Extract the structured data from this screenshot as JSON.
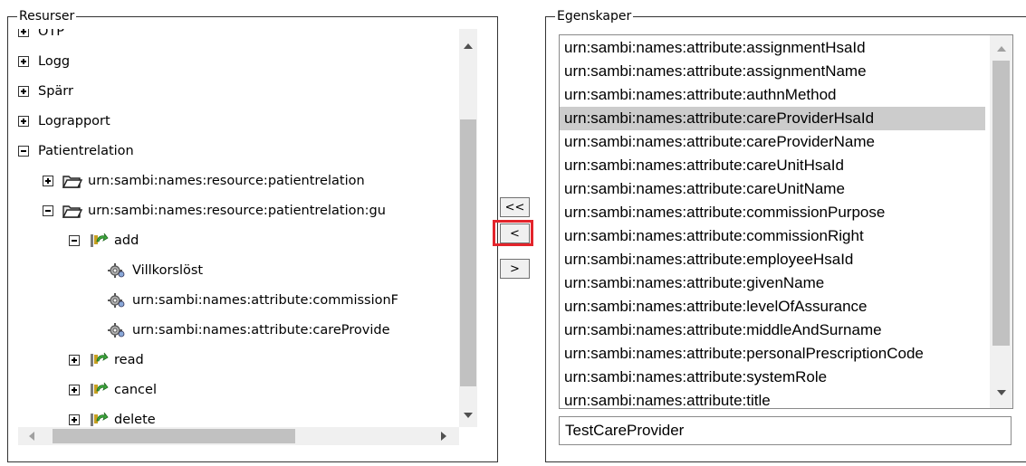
{
  "resources": {
    "legend": "Resurser",
    "rows": [
      {
        "label": "OTP",
        "level": 0,
        "toggle": "plus",
        "icon": ""
      },
      {
        "label": "Logg",
        "level": 0,
        "toggle": "plus",
        "icon": ""
      },
      {
        "label": "Spärr",
        "level": 0,
        "toggle": "plus",
        "icon": ""
      },
      {
        "label": "Lograpport",
        "level": 0,
        "toggle": "plus",
        "icon": ""
      },
      {
        "label": "Patientrelation",
        "level": 0,
        "toggle": "minus",
        "icon": ""
      },
      {
        "label": "urn:sambi:names:resource:patientrelation",
        "level": 1,
        "toggle": "plus",
        "icon": "folder-icon"
      },
      {
        "label": "urn:sambi:names:resource:patientrelation:gu",
        "level": 1,
        "toggle": "minus",
        "icon": "folder-icon"
      },
      {
        "label": "add",
        "level": 2,
        "toggle": "minus",
        "icon": "action-icon"
      },
      {
        "label": "Villkorslöst",
        "level": 3,
        "toggle": "",
        "icon": "gear-icon"
      },
      {
        "label": "urn:sambi:names:attribute:commissionF",
        "level": 3,
        "toggle": "",
        "icon": "gear-icon"
      },
      {
        "label": "urn:sambi:names:attribute:careProvide",
        "level": 3,
        "toggle": "",
        "icon": "gear-icon"
      },
      {
        "label": "read",
        "level": 2,
        "toggle": "plus",
        "icon": "action-icon"
      },
      {
        "label": "cancel",
        "level": 2,
        "toggle": "plus",
        "icon": "action-icon"
      },
      {
        "label": "delete",
        "level": 2,
        "toggle": "plus",
        "icon": "action-icon"
      }
    ]
  },
  "transfer": {
    "add_all_label": "<<",
    "add_label": "<",
    "remove_label": ">"
  },
  "properties": {
    "legend": "Egenskaper",
    "items": [
      "urn:sambi:names:attribute:assignmentHsaId",
      "urn:sambi:names:attribute:assignmentName",
      "urn:sambi:names:attribute:authnMethod",
      "urn:sambi:names:attribute:careProviderHsaId",
      "urn:sambi:names:attribute:careProviderName",
      "urn:sambi:names:attribute:careUnitHsaId",
      "urn:sambi:names:attribute:careUnitName",
      "urn:sambi:names:attribute:commissionPurpose",
      "urn:sambi:names:attribute:commissionRight",
      "urn:sambi:names:attribute:employeeHsaId",
      "urn:sambi:names:attribute:givenName",
      "urn:sambi:names:attribute:levelOfAssurance",
      "urn:sambi:names:attribute:middleAndSurname",
      "urn:sambi:names:attribute:personalPrescriptionCode",
      "urn:sambi:names:attribute:systemRole",
      "urn:sambi:names:attribute:title"
    ],
    "selected_index": 3,
    "value_input": "TestCareProvider"
  },
  "colors": {
    "highlight_box": "#e3242b",
    "selection": "#cccccc"
  }
}
